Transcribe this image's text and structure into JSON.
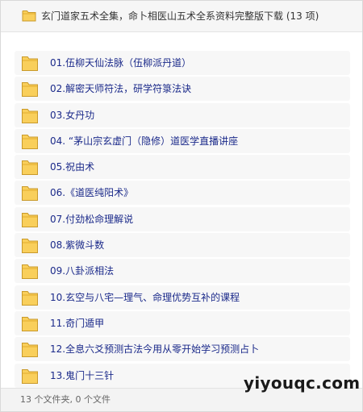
{
  "header": {
    "title": "玄门道家五术全集，命卜相医山五术全系资料完整版下载 (13 项)",
    "icon": "folder-icon"
  },
  "items": [
    {
      "label": "01.伍柳天仙法脉（伍柳派丹道）",
      "icon": "folder-icon"
    },
    {
      "label": "02.解密天师符法，研学符箓法诀",
      "icon": "folder-icon"
    },
    {
      "label": "03.女丹功",
      "icon": "folder-icon"
    },
    {
      "label": "04. “茅山宗玄虚门（隐修）道医学直播讲座",
      "icon": "folder-icon"
    },
    {
      "label": "05.祝由术",
      "icon": "folder-icon"
    },
    {
      "label": "06.《道医纯阳术》",
      "icon": "folder-icon"
    },
    {
      "label": "07.付劲松命理解说",
      "icon": "folder-icon"
    },
    {
      "label": "08.紫微斗数",
      "icon": "folder-icon"
    },
    {
      "label": "09.八卦派相法",
      "icon": "folder-icon"
    },
    {
      "label": "10.玄空与八宅—理气、命理优势互补的课程",
      "icon": "folder-icon"
    },
    {
      "label": "11.奇门遁甲",
      "icon": "folder-icon"
    },
    {
      "label": "12.全息六爻预测古法今用从零开始学习预测占卜",
      "icon": "folder-icon"
    },
    {
      "label": "13.鬼门十三针",
      "icon": "folder-icon"
    }
  ],
  "footer": {
    "status": "13 个文件夹, 0 个文件"
  },
  "watermark": {
    "text": "yiyouqc.com"
  },
  "colors": {
    "folder_fill": "#f9cf5b",
    "folder_tab": "#f0b93a",
    "folder_stroke": "#c99a2a",
    "label_text": "#1b2a8a",
    "row_background": "#f7f7f7"
  }
}
